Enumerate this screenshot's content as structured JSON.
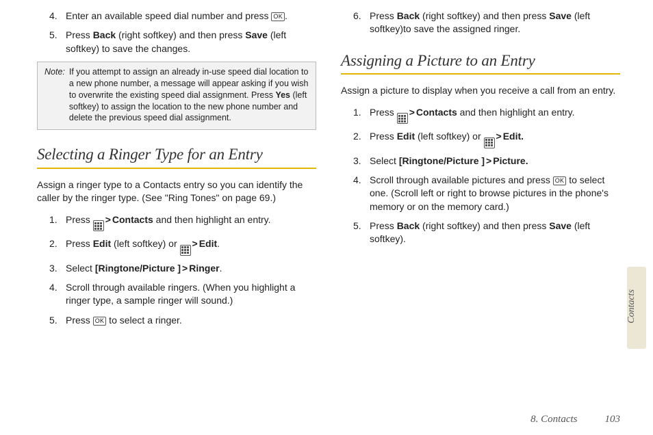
{
  "left": {
    "steps_a": [
      {
        "num": "4.",
        "pre": "Enter an available speed dial number and press ",
        "key": "OK",
        "post": "."
      },
      {
        "num": "5.",
        "segments": [
          {
            "t": "Press "
          },
          {
            "b": "Back"
          },
          {
            "t": " (right softkey) and then press "
          },
          {
            "b": "Save"
          },
          {
            "t": " (left softkey) to save the changes."
          }
        ]
      }
    ],
    "note_label": "Note:",
    "note_body": "If you attempt to assign an already in-use speed dial location to a new phone number, a message will appear asking if you wish to overwrite the existing speed dial assignment. Press Yes (left softkey) to assign the location to the new phone number and delete the previous speed dial assignment.",
    "heading": "Selecting a Ringer Type for an Entry",
    "intro": "Assign a ringer type to a Contacts entry so you can identify the caller by the ringer type. (See \"Ring Tones\" on page 69.)",
    "steps_b": [
      {
        "num": "1.",
        "segments": [
          {
            "t": "Press "
          },
          {
            "grid": true
          },
          {
            "gt": " > "
          },
          {
            "b": "Contacts"
          },
          {
            "t": " and then highlight an entry."
          }
        ]
      },
      {
        "num": "2.",
        "segments": [
          {
            "t": "Press "
          },
          {
            "b": "Edit"
          },
          {
            "t": " (left softkey)  or  "
          },
          {
            "grid": true
          },
          {
            "gt": " > "
          },
          {
            "b": "Edit"
          },
          {
            "t": "."
          }
        ]
      },
      {
        "num": "3.",
        "segments": [
          {
            "t": "Select "
          },
          {
            "b": "[Ringtone/Picture ]"
          },
          {
            "gt": " > "
          },
          {
            "b": "Ringer"
          },
          {
            "t": "."
          }
        ]
      },
      {
        "num": "4.",
        "segments": [
          {
            "t": "Scroll through available ringers. (When you highlight a ringer type, a sample ringer will sound.)"
          }
        ]
      },
      {
        "num": "5.",
        "segments": [
          {
            "t": "Press "
          },
          {
            "ok": true
          },
          {
            "t": " to select a ringer."
          }
        ]
      }
    ]
  },
  "right": {
    "steps_a": [
      {
        "num": "6.",
        "segments": [
          {
            "t": "Press "
          },
          {
            "b": "Back"
          },
          {
            "t": " (right softkey) and then press "
          },
          {
            "b": "Save"
          },
          {
            "t": " (left softkey)to save the assigned ringer."
          }
        ]
      }
    ],
    "heading": "Assigning a Picture to an Entry",
    "intro": "Assign a picture to display when you receive a call from an entry.",
    "steps_b": [
      {
        "num": "1.",
        "segments": [
          {
            "t": "Press "
          },
          {
            "grid": true
          },
          {
            "gt": " > "
          },
          {
            "b": "Contacts"
          },
          {
            "t": " and then highlight an entry."
          }
        ]
      },
      {
        "num": "2.",
        "segments": [
          {
            "t": "Press "
          },
          {
            "b": "Edit"
          },
          {
            "t": " (left softkey)  or  "
          },
          {
            "grid": true
          },
          {
            "gt": " > "
          },
          {
            "b": "Edit."
          }
        ]
      },
      {
        "num": "3.",
        "segments": [
          {
            "t": "Select "
          },
          {
            "b": "[Ringtone/Picture ]"
          },
          {
            "gt": " >  "
          },
          {
            "b": "Picture."
          }
        ]
      },
      {
        "num": "4.",
        "segments": [
          {
            "t": "Scroll through available pictures and press "
          },
          {
            "ok": true
          },
          {
            "t": " to select one. (Scroll left or right  to browse pictures in the phone's memory or on the memory card.)"
          }
        ]
      },
      {
        "num": "5.",
        "segments": [
          {
            "t": "Press "
          },
          {
            "b": "Back"
          },
          {
            "t": " (right softkey) and then press "
          },
          {
            "b": "Save"
          },
          {
            "t": " (left softkey)."
          }
        ]
      }
    ]
  },
  "side_tab": "Contacts",
  "footer_chapter": "8. Contacts",
  "footer_page": "103"
}
